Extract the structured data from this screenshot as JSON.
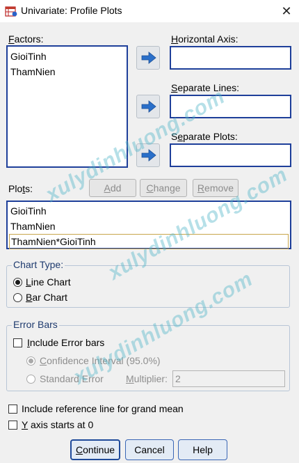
{
  "window": {
    "title": "Univariate: Profile Plots",
    "close_glyph": "✕"
  },
  "factors": {
    "label": "Factors:",
    "items": [
      "GioiTinh",
      "ThamNien"
    ]
  },
  "horizontal_axis": {
    "label": "Horizontal Axis:",
    "value": ""
  },
  "separate_lines": {
    "label": "Separate Lines:",
    "value": ""
  },
  "separate_plots": {
    "label": "Separate Plots:",
    "value": ""
  },
  "plots": {
    "label": "Plots:",
    "add_label": "Add",
    "change_label": "Change",
    "remove_label": "Remove",
    "items": [
      "GioiTinh",
      "ThamNien",
      "ThamNien*GioiTinh"
    ]
  },
  "chart_type": {
    "title": "Chart Type:",
    "line_label": "Line Chart",
    "bar_label": "Bar Chart",
    "selected": "Line Chart"
  },
  "error_bars": {
    "title": "Error Bars",
    "include_label": "Include Error bars",
    "include_checked": false,
    "ci_label": "Confidence Interval (95.0%)",
    "se_label": "Standard Error",
    "multiplier_label": "Multiplier:",
    "multiplier_value": "2"
  },
  "options": {
    "grand_mean_label": "Include reference line for grand mean",
    "y_axis_label": "Y axis starts at 0"
  },
  "buttons": {
    "continue": "Continue",
    "cancel": "Cancel",
    "help": "Help"
  },
  "watermark": "xulydinhluong.com",
  "colors": {
    "accent": "#1e3f9a",
    "arrow": "#2a6fc9",
    "button_bg": "#e3ebf5"
  }
}
